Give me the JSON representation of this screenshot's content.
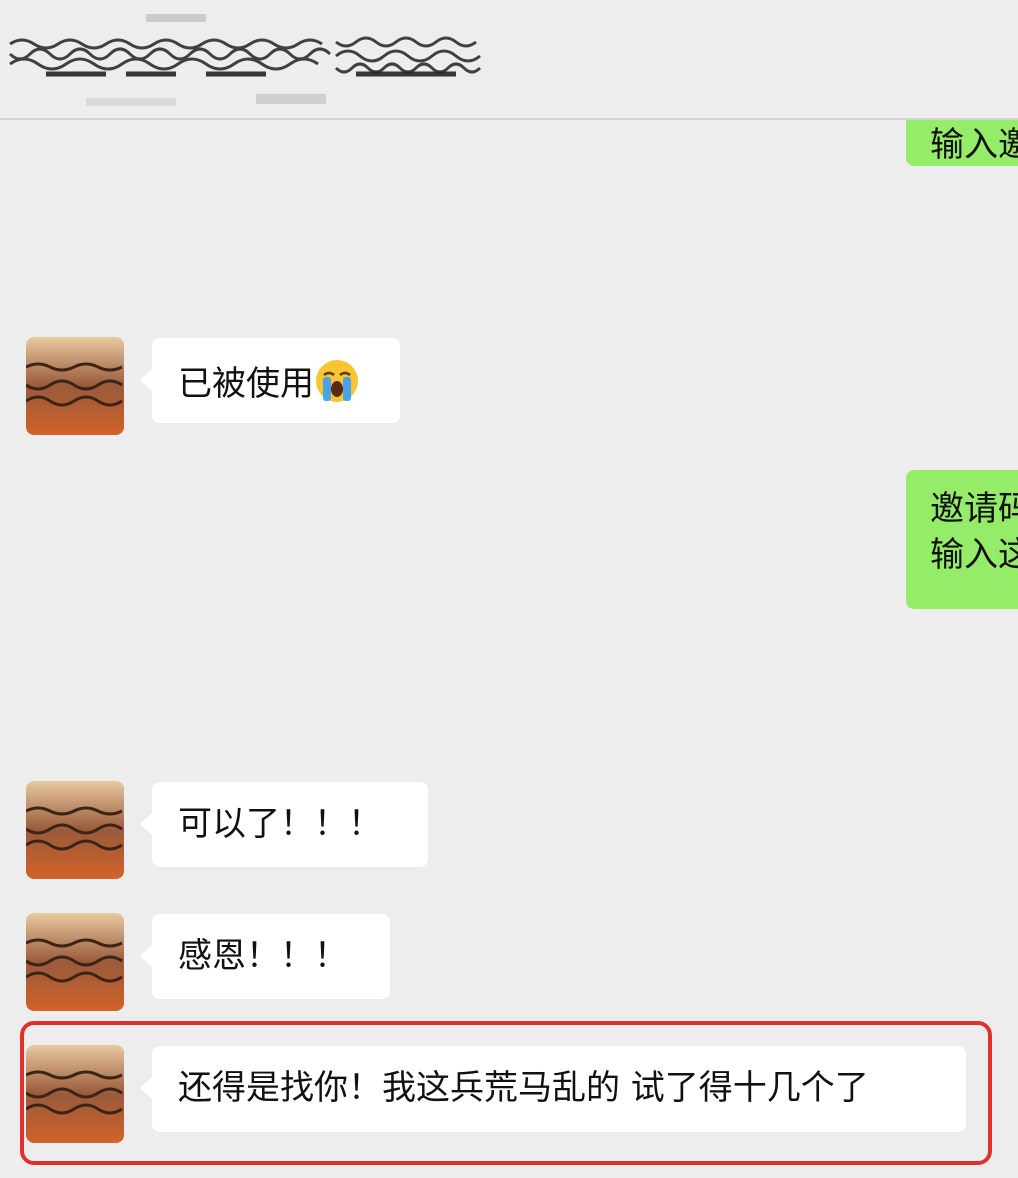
{
  "header": {
    "contact_name_obscured": "contact-name-censored"
  },
  "messages": [
    {
      "side": "right",
      "lines": [
        "输入邀"
      ]
    },
    {
      "side": "left",
      "text": "已被使用",
      "emoji": "loudly-crying-face"
    },
    {
      "side": "right",
      "lines": [
        "邀请码",
        "输入这"
      ]
    },
    {
      "side": "left",
      "text": "可以了！！！"
    },
    {
      "side": "left",
      "text": "感恩！！！"
    },
    {
      "side": "left",
      "text": "还得是找你！我这兵荒马乱的 试了得十几个了",
      "highlighted": true
    }
  ],
  "colors": {
    "background": "#ededed",
    "incoming_bubble": "#ffffff",
    "outgoing_bubble": "#95ec69",
    "highlight_border": "#e0302c"
  }
}
